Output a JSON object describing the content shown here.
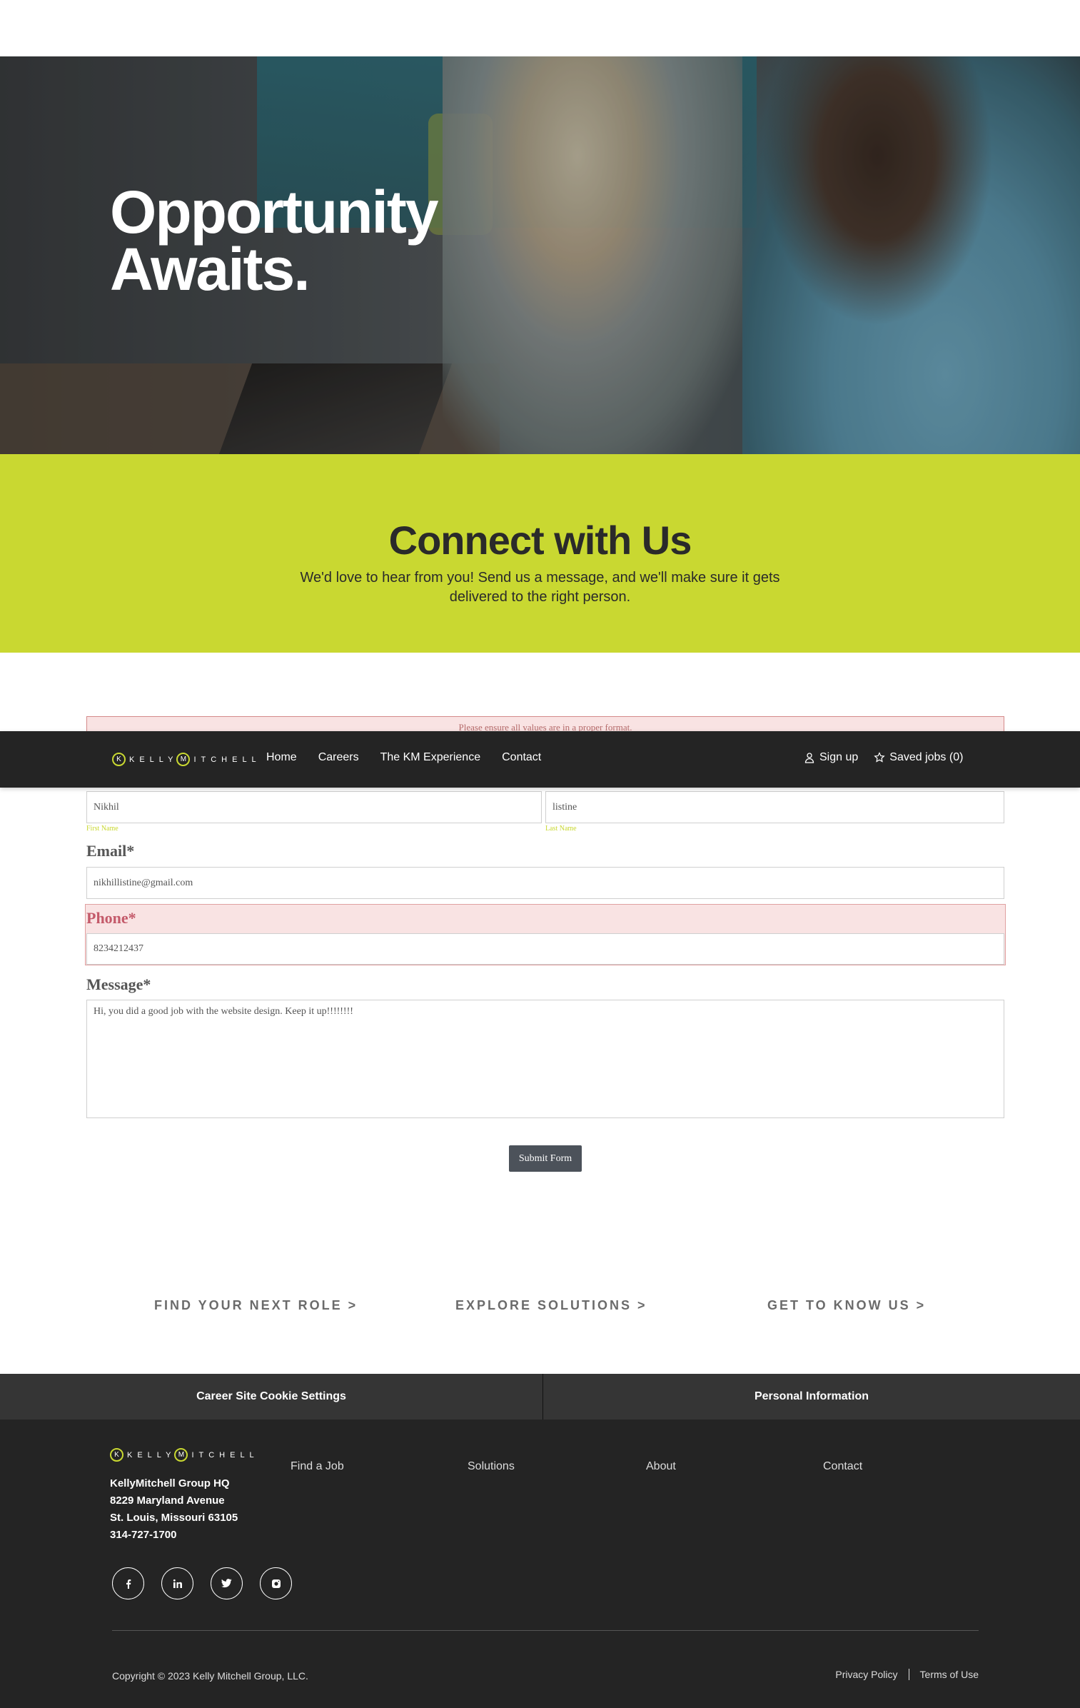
{
  "hero": {
    "title_line1": "Opportunity",
    "title_line2": "Awaits."
  },
  "connect": {
    "title": "Connect with Us",
    "subtitle": "We'd love to hear from you! Send us a message, and we'll make sure it gets delivered to the right person."
  },
  "form": {
    "error_message": "Please ensure all values are in a proper format.",
    "first_name": {
      "value": "Nikhil",
      "sublabel": "First Name"
    },
    "last_name": {
      "value": "listine",
      "sublabel": "Last Name"
    },
    "email": {
      "label": "Email*",
      "value": "nikhillistine@gmail.com"
    },
    "phone": {
      "label": "Phone*",
      "value": "8234212437"
    },
    "message": {
      "label": "Message*",
      "value": "Hi, you did a good job with the website design. Keep it up!!!!!!!!"
    },
    "submit_label": "Submit Form"
  },
  "nav": {
    "logo_text_left": "KELLY",
    "logo_text_right": "ITCHELL",
    "logo_ring_k": "K",
    "logo_ring_m": "M",
    "links": [
      "Home",
      "Careers",
      "The KM Experience",
      "Contact"
    ],
    "signup": "Sign up",
    "saved_jobs": "Saved jobs (0)",
    "accent": "#c9d831"
  },
  "ctas": [
    "FIND YOUR NEXT ROLE >",
    "EXPLORE SOLUTIONS >",
    "GET TO KNOW US >"
  ],
  "cookie_bar": {
    "left": "Career Site Cookie Settings",
    "right": "Personal Information"
  },
  "footer": {
    "address": [
      "KellyMitchell Group HQ",
      "8229 Maryland Avenue",
      "St. Louis, Missouri 63105",
      "314-727-1700"
    ],
    "columns": [
      "Find a Job",
      "Solutions",
      "About",
      "Contact"
    ],
    "socials": [
      "f",
      "in",
      "t",
      "ig"
    ],
    "copyright": "Copyright © 2023 Kelly Mitchell Group, LLC.",
    "privacy": "Privacy Policy",
    "terms": "Terms of Use"
  }
}
